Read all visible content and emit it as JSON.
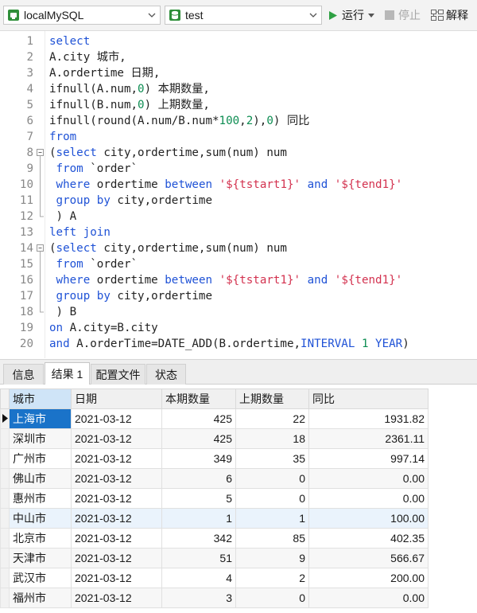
{
  "toolbar": {
    "connection": "localMySQL",
    "database": "test",
    "run_label": "运行",
    "stop_label": "停止",
    "explain_label": "解释"
  },
  "editor": {
    "lines": [
      {
        "no": "1",
        "tokens": [
          {
            "t": "select",
            "k": "kw"
          }
        ]
      },
      {
        "no": "2",
        "tokens": [
          {
            "t": "A.city 城市,",
            "k": ""
          }
        ]
      },
      {
        "no": "3",
        "tokens": [
          {
            "t": "A.ordertime 日期,",
            "k": ""
          }
        ]
      },
      {
        "no": "4",
        "tokens": [
          {
            "t": "ifnull(A.num,",
            "k": ""
          },
          {
            "t": "0",
            "k": "num"
          },
          {
            "t": ") 本期数量,",
            "k": ""
          }
        ]
      },
      {
        "no": "5",
        "tokens": [
          {
            "t": "ifnull(B.num,",
            "k": ""
          },
          {
            "t": "0",
            "k": "num"
          },
          {
            "t": ") 上期数量,",
            "k": ""
          }
        ]
      },
      {
        "no": "6",
        "tokens": [
          {
            "t": "ifnull(round(A.num/B.num*",
            "k": ""
          },
          {
            "t": "100",
            "k": "num"
          },
          {
            "t": ",",
            "k": ""
          },
          {
            "t": "2",
            "k": "num"
          },
          {
            "t": "),",
            "k": ""
          },
          {
            "t": "0",
            "k": "num"
          },
          {
            "t": ") 同比",
            "k": ""
          }
        ]
      },
      {
        "no": "7",
        "tokens": [
          {
            "t": "from",
            "k": "kw"
          }
        ]
      },
      {
        "no": "8",
        "fold": "start",
        "tokens": [
          {
            "t": "(",
            "k": ""
          },
          {
            "t": "select",
            "k": "kw"
          },
          {
            "t": " city,ordertime,sum(num) num",
            "k": ""
          }
        ]
      },
      {
        "no": "9",
        "fold": "mid",
        "tokens": [
          {
            "t": " ",
            "k": ""
          },
          {
            "t": "from",
            "k": "kw"
          },
          {
            "t": " `order`",
            "k": ""
          }
        ]
      },
      {
        "no": "10",
        "fold": "mid",
        "tokens": [
          {
            "t": " ",
            "k": ""
          },
          {
            "t": "where",
            "k": "kw"
          },
          {
            "t": " ordertime ",
            "k": ""
          },
          {
            "t": "between",
            "k": "kw"
          },
          {
            "t": " ",
            "k": ""
          },
          {
            "t": "'${tstart1}'",
            "k": "str"
          },
          {
            "t": " ",
            "k": ""
          },
          {
            "t": "and",
            "k": "kw"
          },
          {
            "t": " ",
            "k": ""
          },
          {
            "t": "'${tend1}'",
            "k": "str"
          }
        ]
      },
      {
        "no": "11",
        "fold": "mid",
        "tokens": [
          {
            "t": " ",
            "k": ""
          },
          {
            "t": "group by",
            "k": "kw"
          },
          {
            "t": " city,ordertime",
            "k": ""
          }
        ]
      },
      {
        "no": "12",
        "fold": "end",
        "tokens": [
          {
            "t": " ) A",
            "k": ""
          }
        ]
      },
      {
        "no": "13",
        "tokens": [
          {
            "t": "left join",
            "k": "kw"
          }
        ]
      },
      {
        "no": "14",
        "fold": "start",
        "tokens": [
          {
            "t": "(",
            "k": ""
          },
          {
            "t": "select",
            "k": "kw"
          },
          {
            "t": " city,ordertime,sum(num) num",
            "k": ""
          }
        ]
      },
      {
        "no": "15",
        "fold": "mid",
        "tokens": [
          {
            "t": " ",
            "k": ""
          },
          {
            "t": "from",
            "k": "kw"
          },
          {
            "t": " `order`",
            "k": ""
          }
        ]
      },
      {
        "no": "16",
        "fold": "mid",
        "tokens": [
          {
            "t": " ",
            "k": ""
          },
          {
            "t": "where",
            "k": "kw"
          },
          {
            "t": " ordertime ",
            "k": ""
          },
          {
            "t": "between",
            "k": "kw"
          },
          {
            "t": " ",
            "k": ""
          },
          {
            "t": "'${tstart1}'",
            "k": "str"
          },
          {
            "t": " ",
            "k": ""
          },
          {
            "t": "and",
            "k": "kw"
          },
          {
            "t": " ",
            "k": ""
          },
          {
            "t": "'${tend1}'",
            "k": "str"
          }
        ]
      },
      {
        "no": "17",
        "fold": "mid",
        "tokens": [
          {
            "t": " ",
            "k": ""
          },
          {
            "t": "group by",
            "k": "kw"
          },
          {
            "t": " city,ordertime",
            "k": ""
          }
        ]
      },
      {
        "no": "18",
        "fold": "end",
        "tokens": [
          {
            "t": " ) B",
            "k": ""
          }
        ]
      },
      {
        "no": "19",
        "tokens": [
          {
            "t": "on",
            "k": "kw"
          },
          {
            "t": " A.city=B.city",
            "k": ""
          }
        ]
      },
      {
        "no": "20",
        "tokens": [
          {
            "t": "and",
            "k": "kw"
          },
          {
            "t": " A.orderTime=DATE_ADD(B.ordertime,",
            "k": ""
          },
          {
            "t": "INTERVAL",
            "k": "kw"
          },
          {
            "t": " ",
            "k": ""
          },
          {
            "t": "1",
            "k": "num"
          },
          {
            "t": " ",
            "k": ""
          },
          {
            "t": "YEAR",
            "k": "kw"
          },
          {
            "t": ")",
            "k": ""
          }
        ]
      }
    ]
  },
  "tabs": [
    {
      "label": "信息",
      "active": false
    },
    {
      "label": "结果 1",
      "active": true
    },
    {
      "label": "配置文件",
      "active": false
    },
    {
      "label": "状态",
      "active": false
    }
  ],
  "result": {
    "columns": [
      "城市",
      "日期",
      "本期数量",
      "上期数量",
      "同比"
    ],
    "rows": [
      [
        "上海市",
        "2021-03-12",
        "425",
        "22",
        "1931.82"
      ],
      [
        "深圳市",
        "2021-03-12",
        "425",
        "18",
        "2361.11"
      ],
      [
        "广州市",
        "2021-03-12",
        "349",
        "35",
        "997.14"
      ],
      [
        "佛山市",
        "2021-03-12",
        "6",
        "0",
        "0.00"
      ],
      [
        "惠州市",
        "2021-03-12",
        "5",
        "0",
        "0.00"
      ],
      [
        "中山市",
        "2021-03-12",
        "1",
        "1",
        "100.00"
      ],
      [
        "北京市",
        "2021-03-12",
        "342",
        "85",
        "402.35"
      ],
      [
        "天津市",
        "2021-03-12",
        "51",
        "9",
        "566.67"
      ],
      [
        "武汉市",
        "2021-03-12",
        "4",
        "2",
        "200.00"
      ],
      [
        "福州市",
        "2021-03-12",
        "3",
        "0",
        "0.00"
      ]
    ]
  },
  "colors": {
    "keyword": "#1f52d6",
    "string": "#d3324f",
    "number": "#0d8d52",
    "run": "#2ea043",
    "selection": "#1a73c9"
  }
}
